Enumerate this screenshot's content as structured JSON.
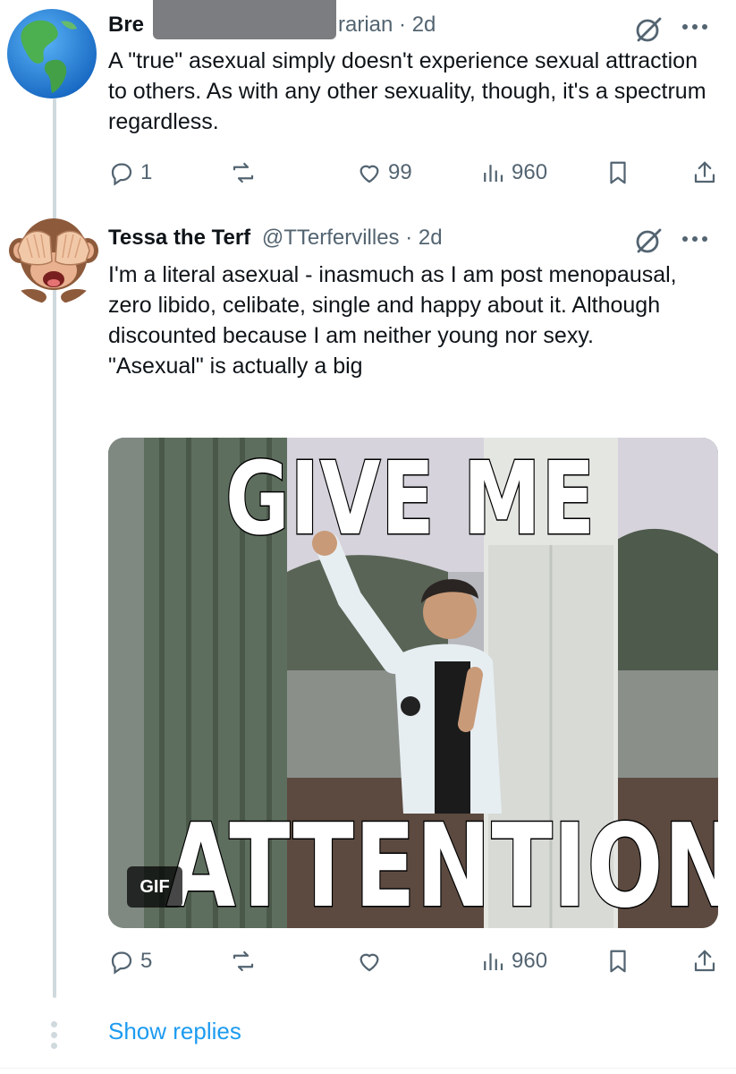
{
  "tweet1": {
    "name_visible": "Bre",
    "handle_tail": "rarian",
    "time": "2d",
    "text": "A \"true\" asexual simply doesn't experience sexual attraction to others. As with any other sexuality, though, it's a spectrum regardless.",
    "avatar_icon": "globe-americas-icon",
    "replies": "1",
    "likes": "99",
    "views": "960"
  },
  "tweet2": {
    "name": "Tessa the Terf",
    "handle": "@TTerfervilles",
    "time": "2d",
    "text_lines": [
      "I'm a literal asexual - inasmuch as I am post menopausal, zero libido, celibate, single and happy about it.  Although discounted because I am neither young nor sexy.",
      "\"Asexual\" is actually a big"
    ],
    "avatar_icon": "see-no-evil-monkey-icon",
    "gif": {
      "badge": "GIF",
      "caption_top": "GIVE  ME",
      "caption_bottom": "ATTENTION!"
    },
    "replies": "5",
    "views": "960"
  },
  "show_replies": "Show replies",
  "colors": {
    "accent": "#1d9bf0",
    "muted": "#536471",
    "thread_line": "#cfd9de"
  }
}
